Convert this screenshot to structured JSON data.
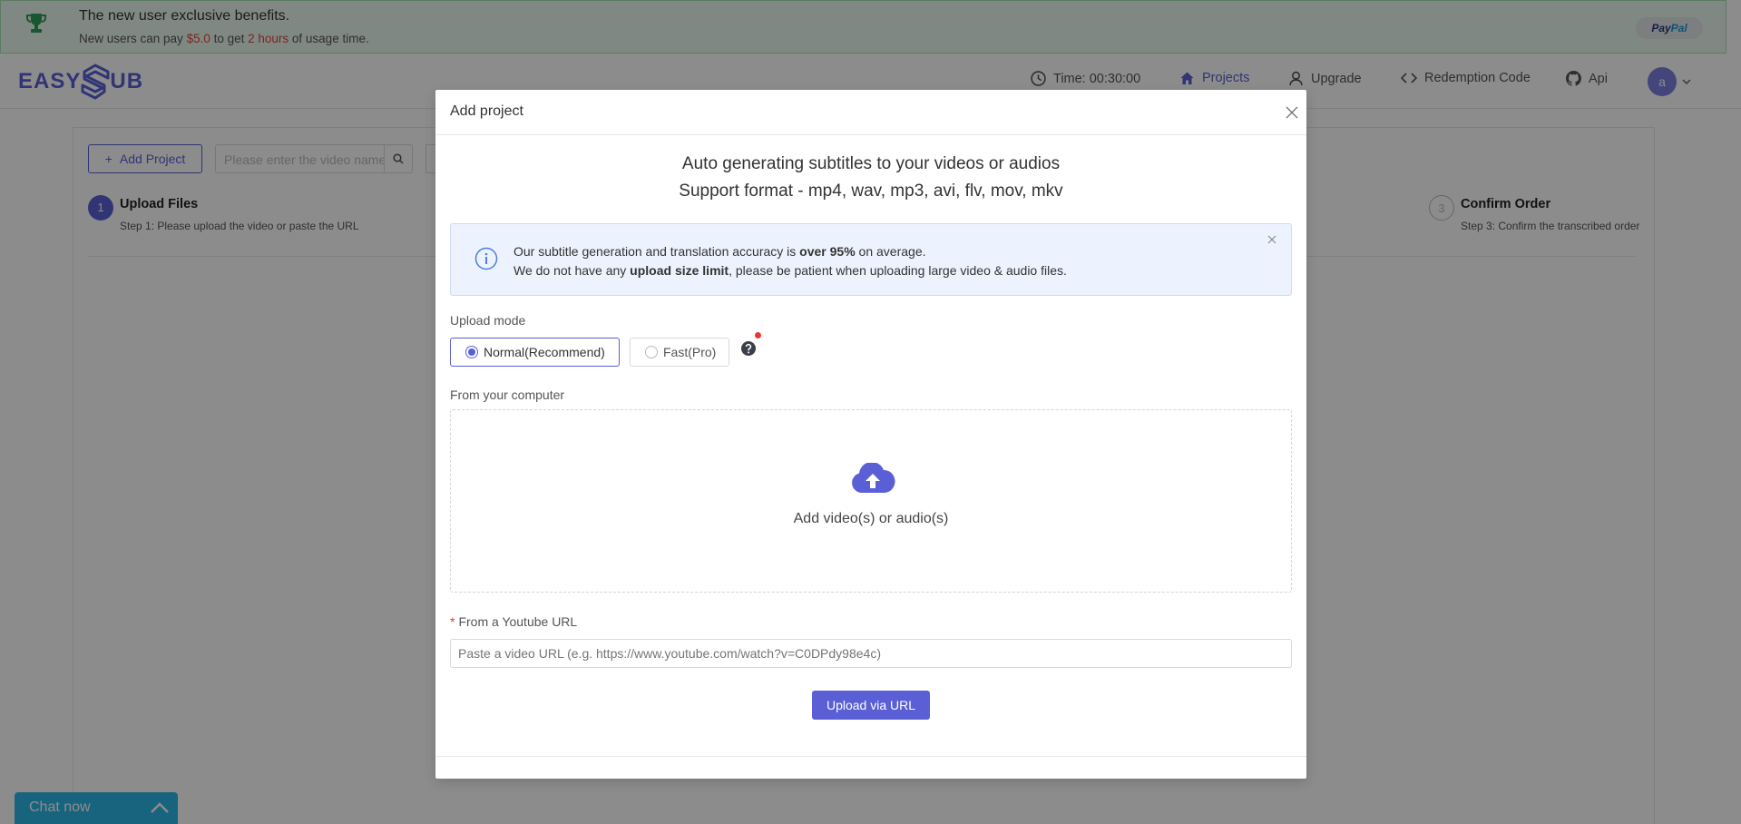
{
  "promo": {
    "title": "The new user exclusive benefits.",
    "sub_prefix": "New users can pay ",
    "sub_price": "$5.0",
    "sub_middle": " to get ",
    "sub_hours": "2 hours",
    "sub_suffix": " of usage time.",
    "paypal_pay": "Pay",
    "paypal_pal": "Pal"
  },
  "header": {
    "logo_left": "EASY",
    "logo_right": "UB",
    "nav": {
      "time": "Time: 00:30:00",
      "projects": "Projects",
      "upgrade": "Upgrade",
      "redemption": "Redemption Code",
      "api": "Api"
    },
    "avatar": "a"
  },
  "page": {
    "add_project_label": "Add Project",
    "search_placeholder": "Please enter the video name",
    "steps": [
      {
        "num": "1",
        "title": "Upload Files",
        "desc": "Step 1: Please upload the video or paste the URL"
      },
      {
        "num": "3",
        "title": "Confirm Order",
        "desc": "Step 3: Confirm the transcribed order"
      }
    ]
  },
  "chat": {
    "label": "Chat now"
  },
  "modal": {
    "title": "Add project",
    "hero_line1": "Auto generating subtitles to your videos or audios",
    "hero_line2": "Support format - mp4, wav, mp3, avi, flv, mov, mkv",
    "info": {
      "l1_a": "Our subtitle generation and translation accuracy is ",
      "l1_b": "over 95%",
      "l1_c": " on average.",
      "l2_a": "We do not have any ",
      "l2_b": "upload size limit",
      "l2_c": ", please be patient when uploading large video & audio files."
    },
    "upload_mode_label": "Upload mode",
    "modes": [
      {
        "label": "Normal(Recommend)",
        "selected": true
      },
      {
        "label": "Fast(Pro)",
        "selected": false
      }
    ],
    "computer_label": "From your computer",
    "drop_text": "Add video(s) or audio(s)",
    "required_mark": "*",
    "youtube_label": "From a Youtube URL",
    "url_placeholder": "Paste a video URL (e.g. https://www.youtube.com/watch?v=C0DPdy98e4c)",
    "upload_url_button": "Upload via URL"
  },
  "colors": {
    "accent": "#5a5fd6",
    "promo_bg": "#eaf7ee",
    "danger": "#e53935",
    "chat": "#2db7e8"
  }
}
